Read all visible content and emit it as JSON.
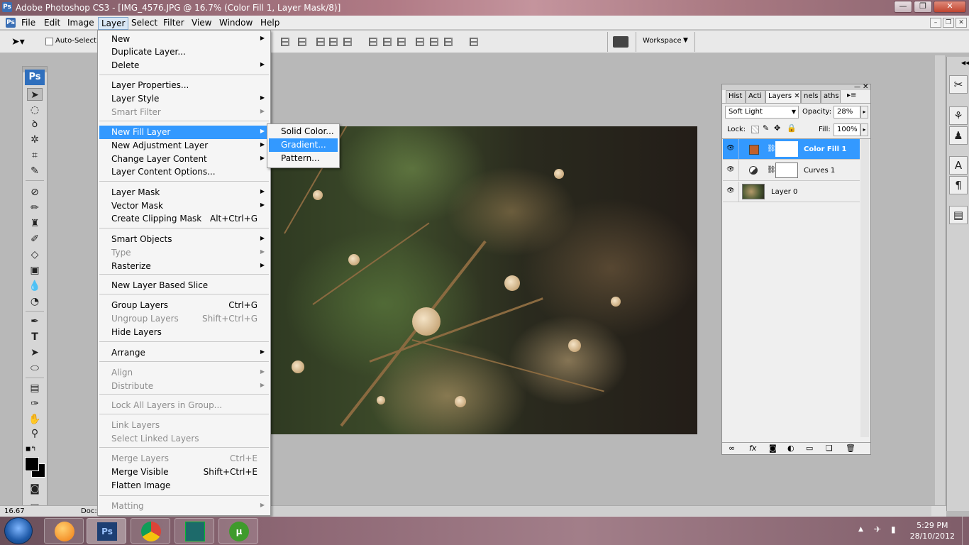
{
  "window": {
    "title": "Adobe Photoshop CS3 - [IMG_4576.JPG @ 16.7% (Color Fill 1, Layer Mask/8)]",
    "min": "—",
    "max": "❐",
    "close": "✕"
  },
  "menubar": {
    "items": [
      "File",
      "Edit",
      "Image",
      "Layer",
      "Select",
      "Filter",
      "View",
      "Window",
      "Help"
    ],
    "active": "Layer"
  },
  "options": {
    "auto_select": "Auto-Select:",
    "workspace": "Workspace"
  },
  "layer_menu": {
    "items": [
      {
        "label": "New",
        "arrow": "▶",
        "disabled": false
      },
      {
        "label": "Duplicate Layer...",
        "disabled": false
      },
      {
        "label": "Delete",
        "arrow": "▶",
        "disabled": false
      },
      {
        "label": "Layer Properties...",
        "disabled": false
      },
      {
        "label": "Layer Style",
        "arrow": "▶",
        "disabled": false
      },
      {
        "label": "Smart Filter",
        "arrow": "▶",
        "disabled": true
      },
      {
        "label": "New Fill Layer",
        "arrow": "▶",
        "disabled": false,
        "highlight": true
      },
      {
        "label": "New Adjustment Layer",
        "arrow": "▶",
        "disabled": false
      },
      {
        "label": "Change Layer Content",
        "arrow": "▶",
        "disabled": false
      },
      {
        "label": "Layer Content Options...",
        "disabled": false
      },
      {
        "label": "Layer Mask",
        "arrow": "▶",
        "disabled": false
      },
      {
        "label": "Vector Mask",
        "arrow": "▶",
        "disabled": false
      },
      {
        "label": "Create Clipping Mask",
        "shortcut": "Alt+Ctrl+G",
        "disabled": false
      },
      {
        "label": "Smart Objects",
        "arrow": "▶",
        "disabled": false
      },
      {
        "label": "Type",
        "arrow": "▶",
        "disabled": true
      },
      {
        "label": "Rasterize",
        "arrow": "▶",
        "disabled": false
      },
      {
        "label": "New Layer Based Slice",
        "disabled": false
      },
      {
        "label": "Group Layers",
        "shortcut": "Ctrl+G",
        "disabled": false
      },
      {
        "label": "Ungroup Layers",
        "shortcut": "Shift+Ctrl+G",
        "disabled": true
      },
      {
        "label": "Hide Layers",
        "disabled": false
      },
      {
        "label": "Arrange",
        "arrow": "▶",
        "disabled": false
      },
      {
        "label": "Align",
        "arrow": "▶",
        "disabled": true
      },
      {
        "label": "Distribute",
        "arrow": "▶",
        "disabled": true
      },
      {
        "label": "Lock All Layers in Group...",
        "disabled": true
      },
      {
        "label": "Link Layers",
        "disabled": true
      },
      {
        "label": "Select Linked Layers",
        "disabled": true
      },
      {
        "label": "Merge Layers",
        "shortcut": "Ctrl+E",
        "disabled": true
      },
      {
        "label": "Merge Visible",
        "shortcut": "Shift+Ctrl+E",
        "disabled": false
      },
      {
        "label": "Flatten Image",
        "disabled": false
      },
      {
        "label": "Matting",
        "arrow": "▶",
        "disabled": true
      }
    ]
  },
  "fill_submenu": {
    "items": [
      "Solid Color...",
      "Gradient...",
      "Pattern..."
    ],
    "highlight": "Gradient..."
  },
  "layers_panel": {
    "tabs": [
      "Hist",
      "Acti",
      "Layers",
      "nels",
      "aths"
    ],
    "blend_mode": "Soft Light",
    "opacity_label": "Opacity:",
    "opacity": "28%",
    "lock_label": "Lock:",
    "fill_label": "Fill:",
    "fill": "100%",
    "layers": [
      {
        "name": "Color Fill 1",
        "selected": true
      },
      {
        "name": "Curves 1",
        "selected": false
      },
      {
        "name": "Layer 0",
        "selected": false
      }
    ],
    "fill_swatch": "#c0602a"
  },
  "status": {
    "zoom": "16.67",
    "doc": "Doc:"
  },
  "taskbar": {
    "time": "5:29 PM",
    "date": "28/10/2012"
  }
}
